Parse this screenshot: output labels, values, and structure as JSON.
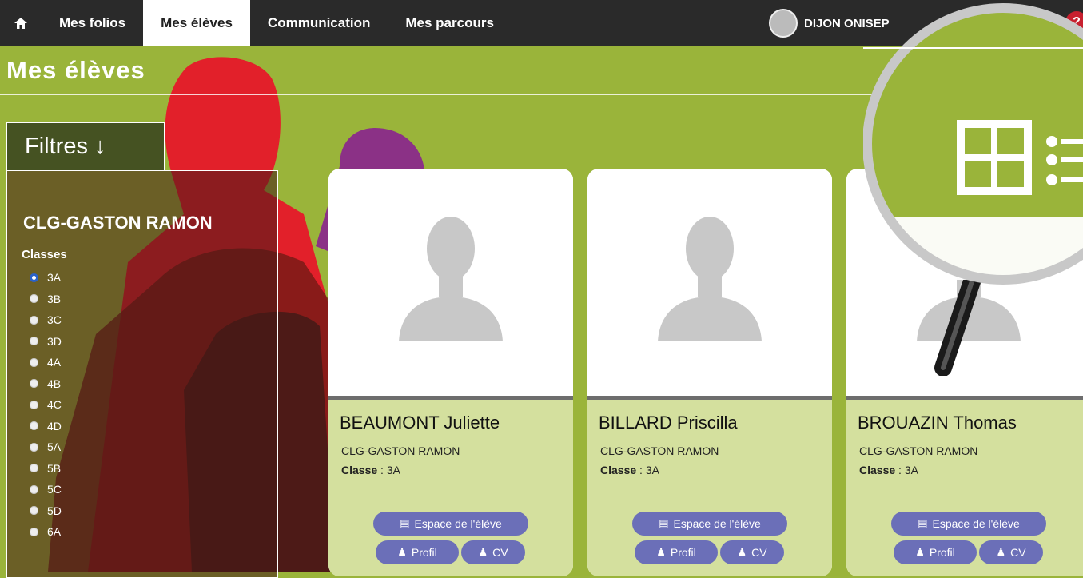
{
  "nav": {
    "home_icon": "home-icon",
    "items": [
      {
        "label": "Mes folios",
        "active": false
      },
      {
        "label": "Mes élèves",
        "active": true
      },
      {
        "label": "Communication",
        "active": false
      },
      {
        "label": "Mes parcours",
        "active": false
      }
    ],
    "user_name": "DIJON ONISEP"
  },
  "page": {
    "title": "Mes élèves"
  },
  "filters": {
    "tab_label": "Filtres ↓",
    "school": "CLG-GASTON RAMON",
    "classes_label": "Classes",
    "classes": [
      "3A",
      "3B",
      "3C",
      "3D",
      "4A",
      "4B",
      "4C",
      "4D",
      "5A",
      "5B",
      "5C",
      "5D",
      "6A"
    ],
    "selected": "3A"
  },
  "students": [
    {
      "name": "BEAUMONT Juliette",
      "school": "CLG-GASTON RAMON",
      "class_label": "Classe",
      "class_value": " : 3A",
      "btn_space": "Espace de l'élève",
      "btn_profile": "Profil",
      "btn_cv": "CV"
    },
    {
      "name": "BILLARD Priscilla",
      "school": "CLG-GASTON RAMON",
      "class_label": "Classe",
      "class_value": " : 3A",
      "btn_space": "Espace de l'élève",
      "btn_profile": "Profil",
      "btn_cv": "CV"
    },
    {
      "name": "BROUAZIN Thomas",
      "school": "CLG-GASTON RAMON",
      "class_label": "Classe",
      "class_value": " : 3A",
      "btn_space": "Espace de l'élève",
      "btn_profile": "Profil",
      "btn_cv": "CV"
    }
  ],
  "colors": {
    "accent": "#9ab43a",
    "nav_bg": "#2a2a2a",
    "button": "#6b6fb8",
    "card_body": "#d4e09e"
  }
}
